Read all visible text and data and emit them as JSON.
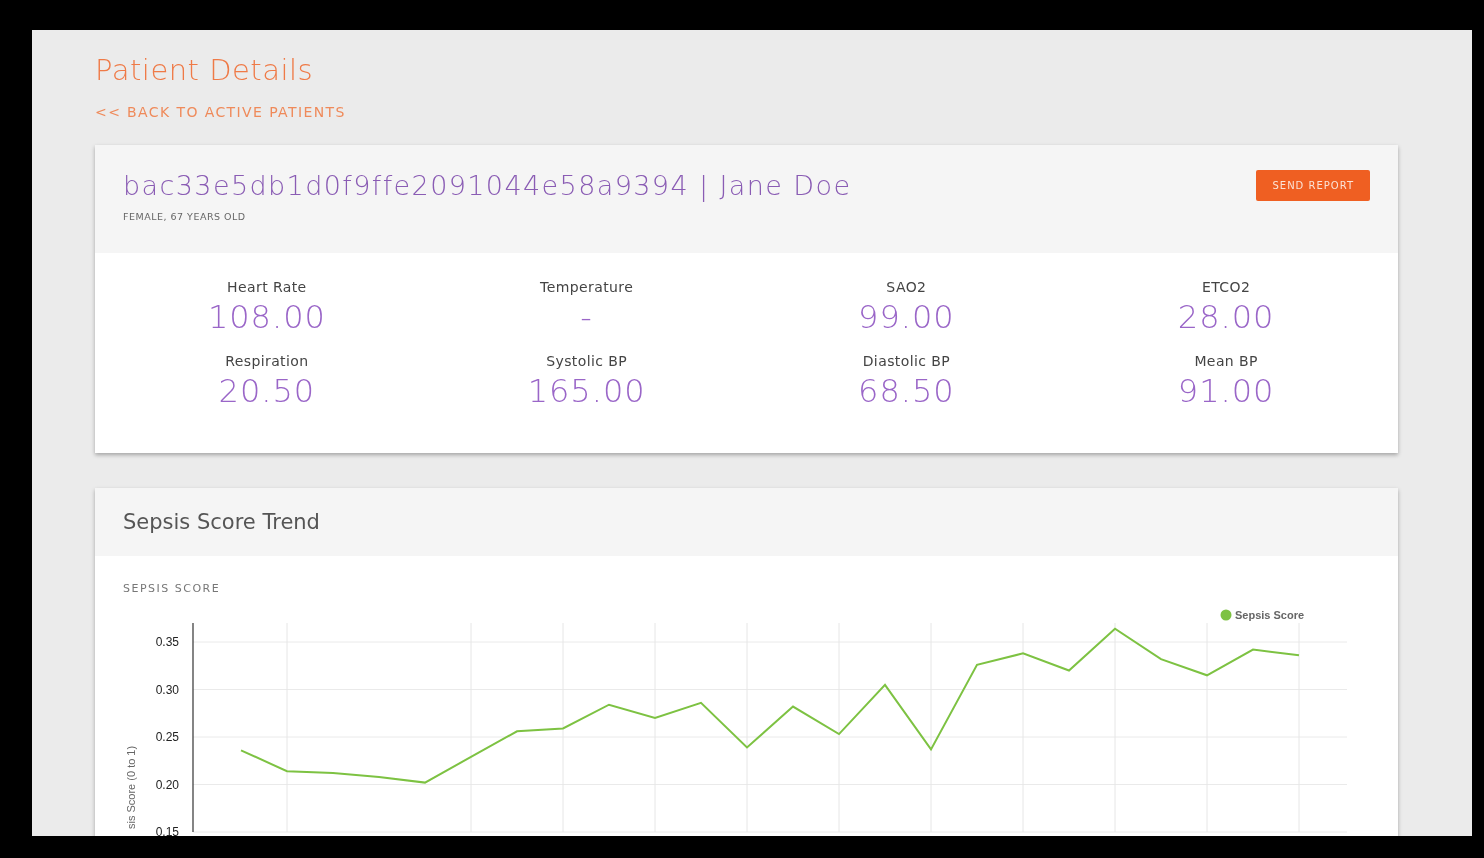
{
  "page": {
    "title": "Patient Details",
    "back_link": "<< BACK TO ACTIVE PATIENTS"
  },
  "patient": {
    "heading": "bac33e5db1d0f9ffe2091044e58a9394 | Jane Doe",
    "subtitle": "FEMALE, 67 YEARS OLD",
    "button": "SEND REPORT",
    "vitals": [
      {
        "label": "Heart Rate",
        "value": "108.00"
      },
      {
        "label": "Temperature",
        "value": "-"
      },
      {
        "label": "SAO2",
        "value": "99.00"
      },
      {
        "label": "ETCO2",
        "value": "28.00"
      },
      {
        "label": "Respiration",
        "value": "20.50"
      },
      {
        "label": "Systolic BP",
        "value": "165.00"
      },
      {
        "label": "Diastolic BP",
        "value": "68.50"
      },
      {
        "label": "Mean BP",
        "value": "91.00"
      }
    ]
  },
  "sepsis": {
    "title": "Sepsis Score Trend",
    "chart_data": {
      "type": "line",
      "title": "SEPSIS SCORE",
      "ylabel": "sis Score (0 to 1)",
      "ylim": [
        0.15,
        0.37
      ],
      "grid": true,
      "yticks": [
        {
          "value": 0.15,
          "label": "0.15"
        },
        {
          "value": 0.2,
          "label": "0.20"
        },
        {
          "value": 0.25,
          "label": "0.25"
        },
        {
          "value": 0.3,
          "label": "0.30"
        },
        {
          "value": 0.35,
          "label": "0.35"
        }
      ],
      "series": [
        {
          "name": "Sepsis Score",
          "color": "#7dc242",
          "values": [
            0.236,
            0.214,
            0.212,
            0.208,
            0.202,
            0.229,
            0.256,
            0.259,
            0.284,
            0.27,
            0.286,
            0.239,
            0.282,
            0.253,
            0.305,
            0.237,
            0.326,
            0.338,
            0.32,
            0.364,
            0.332,
            0.315,
            0.342,
            0.336
          ]
        }
      ]
    }
  }
}
